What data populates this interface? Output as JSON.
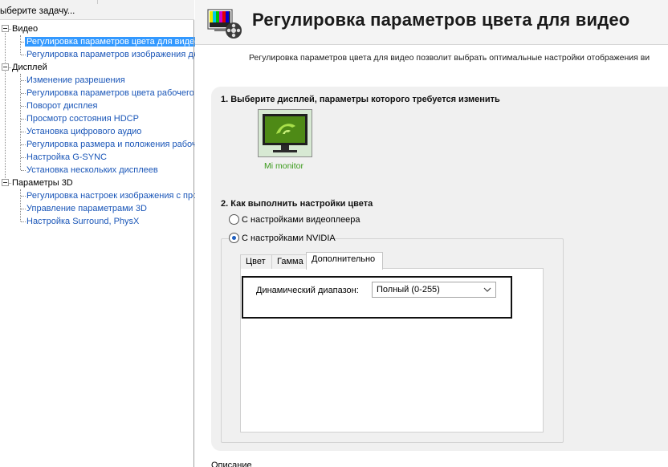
{
  "sidebar": {
    "header": "ыберите задачу...",
    "categories": [
      {
        "label": "Видео",
        "items": [
          {
            "label": "Регулировка параметров цвета для видео",
            "selected": true
          },
          {
            "label": "Регулировка параметров изображения для видео",
            "selected": false
          }
        ]
      },
      {
        "label": "Дисплей",
        "items": [
          {
            "label": "Изменение разрешения"
          },
          {
            "label": "Регулировка параметров цвета рабочего стола"
          },
          {
            "label": "Поворот дисплея"
          },
          {
            "label": "Просмотр состояния HDCP"
          },
          {
            "label": "Установка цифрового аудио"
          },
          {
            "label": "Регулировка размера и положения рабочего стола"
          },
          {
            "label": "Настройка G-SYNC"
          },
          {
            "label": "Установка нескольких дисплеев"
          }
        ]
      },
      {
        "label": "Параметры 3D",
        "items": [
          {
            "label": "Регулировка настроек изображения с просмотром"
          },
          {
            "label": "Управление параметрами 3D"
          },
          {
            "label": "Настройка Surround, PhysX"
          }
        ]
      }
    ]
  },
  "page": {
    "title": "Регулировка параметров цвета для видео",
    "description": "Регулировка параметров цвета для видео позволит выбрать оптимальные настройки отображения ви",
    "section1_title": "1. Выберите дисплей, параметры которого требуется изменить",
    "monitor_name": "Mi monitor",
    "section2_title": "2. Как выполнить настройки цвета",
    "radio_player": "С настройками видеоплеера",
    "radio_nvidia": "С настройками NVIDIA",
    "selected_option": "nvidia",
    "tabs": [
      "Цвет",
      "Гамма",
      "Дополнительно"
    ],
    "active_tab": "Дополнительно",
    "dynamic_range_label": "Динамический диапазон:",
    "dynamic_range_value": "Полный (0-255)",
    "footer_label": "Описание"
  },
  "colors": {
    "accent": "#1a56b8",
    "selection": "#3399ff",
    "nvidia_green": "#76b900",
    "monitor_label": "#3a9a1a"
  }
}
